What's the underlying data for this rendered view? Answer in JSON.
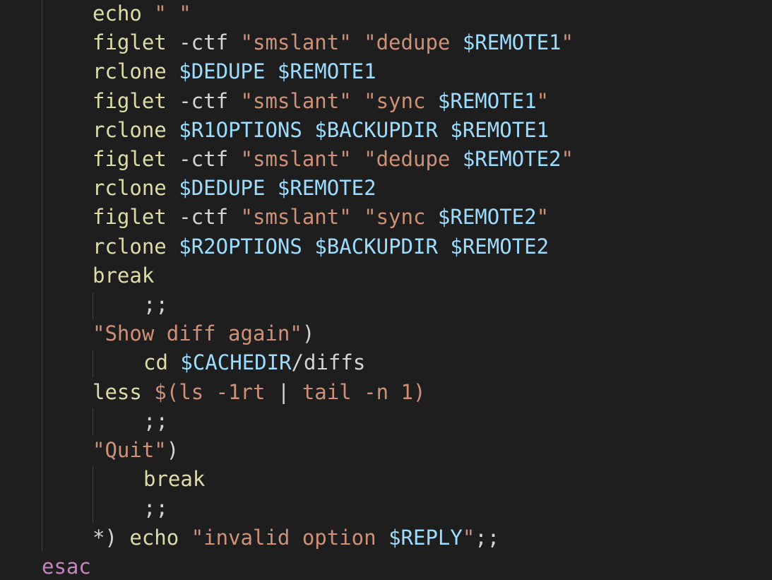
{
  "editor": {
    "language": "bash",
    "theme_colors": {
      "background": "#1e1e1e",
      "command": "#dcdcaa",
      "keyword": "#c586c0",
      "string": "#ce9178",
      "variable": "#9cdcfe",
      "plain": "#d4d4d4"
    },
    "lines": [
      {
        "indent": 2,
        "tokens": [
          [
            "cmd",
            "echo"
          ],
          [
            "pl",
            " "
          ],
          [
            "str",
            "\" \""
          ]
        ]
      },
      {
        "indent": 2,
        "tokens": [
          [
            "cmd",
            "figlet"
          ],
          [
            "pl",
            " -ctf "
          ],
          [
            "str",
            "\"smslant\""
          ],
          [
            "pl",
            " "
          ],
          [
            "str",
            "\"dedupe "
          ],
          [
            "var",
            "$REMOTE1"
          ],
          [
            "str",
            "\""
          ]
        ]
      },
      {
        "indent": 2,
        "tokens": [
          [
            "cmd",
            "rclone"
          ],
          [
            "pl",
            " "
          ],
          [
            "var",
            "$DEDUPE"
          ],
          [
            "pl",
            " "
          ],
          [
            "var",
            "$REMOTE1"
          ]
        ]
      },
      {
        "indent": 2,
        "tokens": [
          [
            "cmd",
            "figlet"
          ],
          [
            "pl",
            " -ctf "
          ],
          [
            "str",
            "\"smslant\""
          ],
          [
            "pl",
            " "
          ],
          [
            "str",
            "\"sync "
          ],
          [
            "var",
            "$REMOTE1"
          ],
          [
            "str",
            "\""
          ]
        ]
      },
      {
        "indent": 2,
        "tokens": [
          [
            "cmd",
            "rclone"
          ],
          [
            "pl",
            " "
          ],
          [
            "var",
            "$R1OPTIONS"
          ],
          [
            "pl",
            " "
          ],
          [
            "var",
            "$BACKUPDIR"
          ],
          [
            "pl",
            " "
          ],
          [
            "var",
            "$REMOTE1"
          ]
        ]
      },
      {
        "indent": 2,
        "tokens": [
          [
            "cmd",
            "figlet"
          ],
          [
            "pl",
            " -ctf "
          ],
          [
            "str",
            "\"smslant\""
          ],
          [
            "pl",
            " "
          ],
          [
            "str",
            "\"dedupe "
          ],
          [
            "var",
            "$REMOTE2"
          ],
          [
            "str",
            "\""
          ]
        ]
      },
      {
        "indent": 2,
        "tokens": [
          [
            "cmd",
            "rclone"
          ],
          [
            "pl",
            " "
          ],
          [
            "var",
            "$DEDUPE"
          ],
          [
            "pl",
            " "
          ],
          [
            "var",
            "$REMOTE2"
          ]
        ]
      },
      {
        "indent": 2,
        "tokens": [
          [
            "cmd",
            "figlet"
          ],
          [
            "pl",
            " -ctf "
          ],
          [
            "str",
            "\"smslant\""
          ],
          [
            "pl",
            " "
          ],
          [
            "str",
            "\"sync "
          ],
          [
            "var",
            "$REMOTE2"
          ],
          [
            "str",
            "\""
          ]
        ]
      },
      {
        "indent": 2,
        "tokens": [
          [
            "cmd",
            "rclone"
          ],
          [
            "pl",
            " "
          ],
          [
            "var",
            "$R2OPTIONS"
          ],
          [
            "pl",
            " "
          ],
          [
            "var",
            "$BACKUPDIR"
          ],
          [
            "pl",
            " "
          ],
          [
            "var",
            "$REMOTE2"
          ]
        ]
      },
      {
        "indent": 2,
        "tokens": [
          [
            "cmd",
            "break"
          ]
        ]
      },
      {
        "indent": 3,
        "tokens": [
          [
            "pn",
            ";;"
          ]
        ]
      },
      {
        "indent": 2,
        "tokens": [
          [
            "str",
            "\"Show diff again\""
          ],
          [
            "pl",
            ")"
          ]
        ]
      },
      {
        "indent": 3,
        "tokens": [
          [
            "cmd",
            "cd"
          ],
          [
            "pl",
            " "
          ],
          [
            "var",
            "$CACHEDIR"
          ],
          [
            "pl",
            "/diffs"
          ]
        ]
      },
      {
        "indent": 2,
        "tokens": [
          [
            "cmd",
            "less"
          ],
          [
            "pl",
            " "
          ],
          [
            "str",
            "$(ls -1rt "
          ],
          [
            "pl",
            "|"
          ],
          [
            "str",
            " tail -n 1)"
          ]
        ]
      },
      {
        "indent": 3,
        "tokens": [
          [
            "pn",
            ";;"
          ]
        ]
      },
      {
        "indent": 2,
        "tokens": [
          [
            "str",
            "\"Quit\""
          ],
          [
            "pl",
            ")"
          ]
        ]
      },
      {
        "indent": 3,
        "tokens": [
          [
            "cmd",
            "break"
          ]
        ]
      },
      {
        "indent": 3,
        "tokens": [
          [
            "pn",
            ";;"
          ]
        ]
      },
      {
        "indent": 2,
        "tokens": [
          [
            "pl",
            "*) "
          ],
          [
            "cmd",
            "echo"
          ],
          [
            "pl",
            " "
          ],
          [
            "str",
            "\"invalid option "
          ],
          [
            "var",
            "$REPLY"
          ],
          [
            "str",
            "\""
          ],
          [
            "pl",
            ";;"
          ]
        ]
      },
      {
        "indent": 1,
        "tokens": [
          [
            "kw",
            "esac"
          ]
        ]
      }
    ]
  }
}
